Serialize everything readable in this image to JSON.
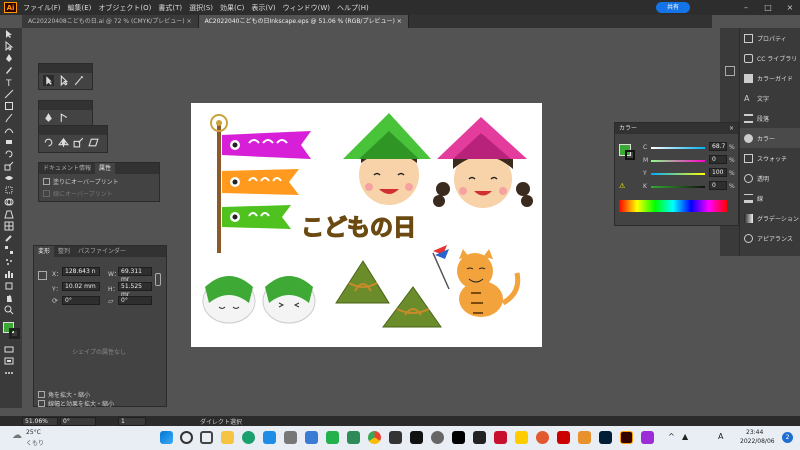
{
  "menubar": {
    "items": [
      "ファイル(F)",
      "編集(E)",
      "オブジェクト(O)",
      "書式(T)",
      "選択(S)",
      "効果(C)",
      "表示(V)",
      "ウィンドウ(W)",
      "ヘルプ(H)"
    ],
    "share_label": "共有"
  },
  "tabs": [
    {
      "label": "AC20220408こどもの日.ai @ 72 % (CMYK/プレビュー)"
    },
    {
      "label": "AC2022040こどもの日Inkscape.eps @ 51.06 % (RGB/プレビュー)"
    }
  ],
  "attributes_panel": {
    "tab_doc_info": "ドキュメント情報",
    "tab_attributes": "属性",
    "overprint_fill": "塗りにオーバープリント",
    "overprint_stroke": "線にオーバープリント"
  },
  "transform_panel": {
    "tab_transform": "変形",
    "tab_align": "整列",
    "tab_pathfinder": "パスファインダー",
    "x_label": "X：",
    "x_value": "128.643 n",
    "y_label": "Y：",
    "y_value": "10.02 mm",
    "w_label": "W：",
    "w_value": "69.311 mr",
    "h_label": "H：",
    "h_value": "51.525 mr",
    "angle_value": "0°",
    "shear_value": "0°",
    "no_shape_props": "シェイプの属性なし",
    "scale_corners": "角を拡大・縮小",
    "scale_strokes": "線幅と効果を拡大・縮小"
  },
  "color_panel": {
    "title": "カラー",
    "c_label": "C",
    "c_value": "68.7",
    "m_label": "M",
    "m_value": "0",
    "y_label": "Y",
    "y_value": "100",
    "k_label": "K",
    "k_value": "0",
    "percent": "%",
    "fill_color": "#3aaa35"
  },
  "right_dock": {
    "items": [
      "プロパティ",
      "CC ライブラリ",
      "カラーガイド",
      "文字",
      "段落",
      "カラー",
      "スウォッチ",
      "透明",
      "線",
      "グラデーション",
      "アピアランス"
    ]
  },
  "artboard": {
    "title_text": "こどもの日"
  },
  "statusbar": {
    "zoom": "51.06%",
    "rotation": "0°",
    "page": "1",
    "tool_name": "ダイレクト選択"
  },
  "taskbar": {
    "temp": "25°C",
    "weather": "くもり",
    "time": "23:44",
    "date": "2022/08/06",
    "lang": "A",
    "notifications": "2"
  }
}
